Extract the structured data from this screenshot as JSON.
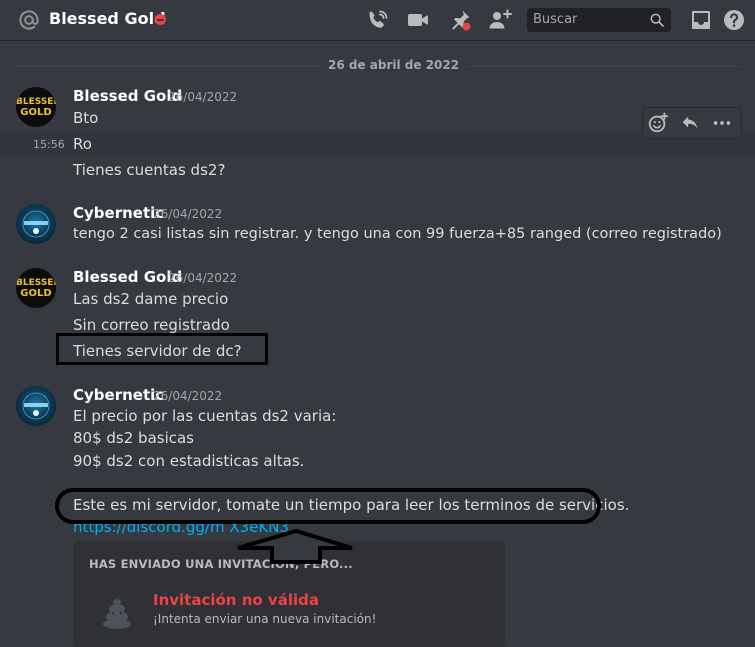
{
  "header": {
    "title": "Blessed Gold",
    "search_placeholder": "Buscar"
  },
  "divider": {
    "date": "26 de abril de 2022"
  },
  "messages": [
    {
      "author": "Blessed Gold",
      "timestamp": "26/04/2022",
      "avatar_text": [
        "BLESSED",
        "GOLD"
      ],
      "lines": [
        "Bto",
        "Ro",
        "Tienes cuentas ds2?"
      ],
      "hover_time": "15:56"
    },
    {
      "author": "Cybernetic",
      "timestamp": "26/04/2022",
      "lines": [
        "tengo 2 casi listas sin registrar. y tengo una con 99 fuerza+85 ranged (correo registrado)"
      ]
    },
    {
      "author": "Blessed Gold",
      "timestamp": "26/04/2022",
      "avatar_text": [
        "BLESSED",
        "GOLD"
      ],
      "lines": [
        "Las ds2 dame precio",
        "Sin correo registrado",
        "Tienes servidor de dc?"
      ]
    },
    {
      "author": "Cybernetic",
      "timestamp": "26/04/2022",
      "lines": [
        "El precio por las cuentas ds2 varia:",
        "80$ ds2 basicas",
        "90$ ds2 con estadisticas altas.",
        "Este es mi servidor, tomate un tiempo para leer los terminos de servicios."
      ],
      "link": "https://discord.gg/m X3eKN3"
    }
  ],
  "invite": {
    "header": "HAS ENVIADO UNA INVITACIÓN, PERO...",
    "title": "Invitación no válida",
    "subtitle": "¡Intenta enviar una nueva invitación!"
  },
  "colors": {
    "background": "#36393f",
    "username": "#ffffff",
    "text": "#dcddde",
    "muted": "#a3a6aa",
    "link": "#00aff4",
    "danger": "#ed4245"
  }
}
